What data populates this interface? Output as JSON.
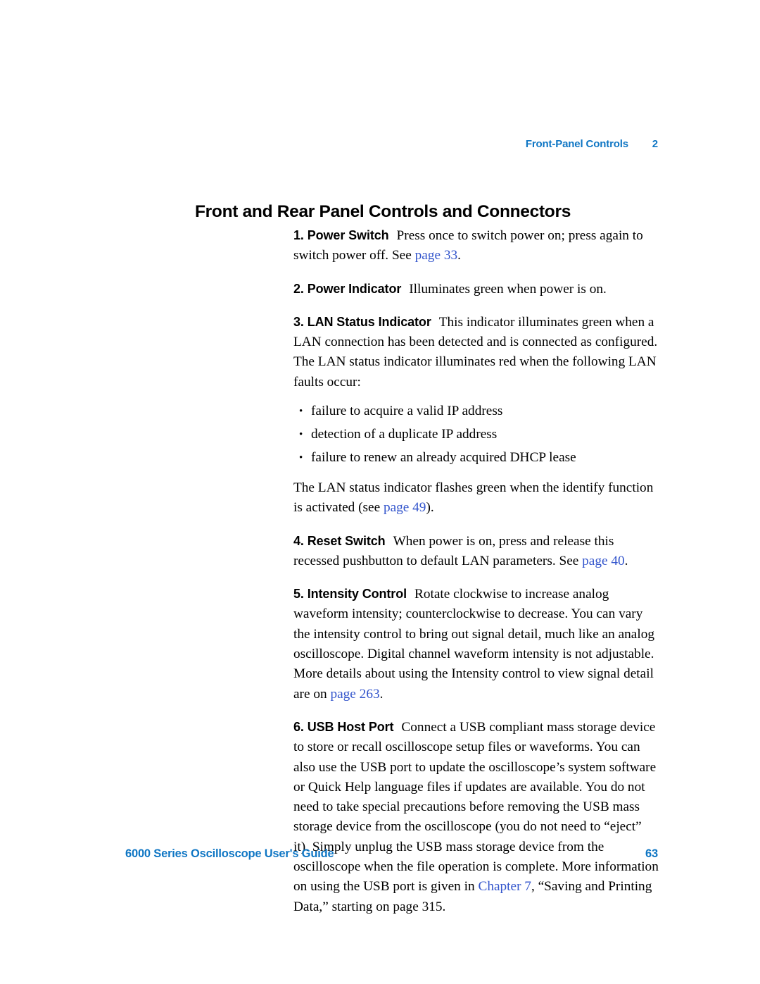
{
  "document": {
    "title": "6000 Series Oscilloscope User's Guide",
    "page_number": "63"
  },
  "running_header": {
    "chapter_title": "Front-Panel Controls",
    "chapter_number": "2"
  },
  "section": {
    "heading": "Front and Rear Panel Controls and Connectors"
  },
  "colors": {
    "header_blue": "#0f76c4",
    "link_blue": "#3355cc",
    "body_black": "#000000"
  },
  "items": {
    "item1": {
      "lead": "1. Power Switch",
      "text_a": "Press once to switch power on; press again to switch power off. See ",
      "link": "page 33",
      "text_b": "."
    },
    "item2": {
      "lead": "2. Power Indicator",
      "text_a": "Illuminates green when power is on."
    },
    "item3": {
      "lead": "3. LAN Status Indicator",
      "text_a": "This indicator illuminates green when a LAN connection has been detected and is connected as configured. The LAN status indicator illuminates red when the following LAN faults occur:",
      "bullet_marker": "•",
      "bullets": [
        "failure to acquire a valid IP address",
        "detection of a duplicate IP address",
        "failure to renew an already acquired DHCP lease"
      ],
      "follow_text_a": "The LAN status indicator flashes green when the identify function is activated (see ",
      "follow_link": "page 49",
      "follow_text_b": ")."
    },
    "item4": {
      "lead": "4. Reset Switch",
      "text_a": "When power is on, press and release this recessed pushbutton to default LAN parameters. See ",
      "link": "page 40",
      "text_b": "."
    },
    "item5": {
      "lead": "5. Intensity Control",
      "text_a": "Rotate clockwise to increase analog waveform intensity; counterclockwise to decrease. You can vary the intensity control to bring out signal detail, much like an analog oscilloscope. Digital channel waveform intensity is not adjustable. More details about using the Intensity control to view signal detail are on ",
      "link": "page 263",
      "text_b": "."
    },
    "item6": {
      "lead": "6. USB Host Port",
      "text_a": "Connect a USB compliant mass storage device to store or recall oscilloscope setup files or waveforms. You can also use the USB port to update the oscilloscope’s system software or Quick Help language files if updates are available. You do not need to take special precautions before removing the USB mass storage device from the oscilloscope (you do not need to “eject” it). Simply unplug the USB mass storage device from the oscilloscope when the file operation is complete. More information on using the USB port is given in ",
      "link": "Chapter 7",
      "text_b": ", “Saving and Printing Data,” starting on page 315."
    }
  }
}
